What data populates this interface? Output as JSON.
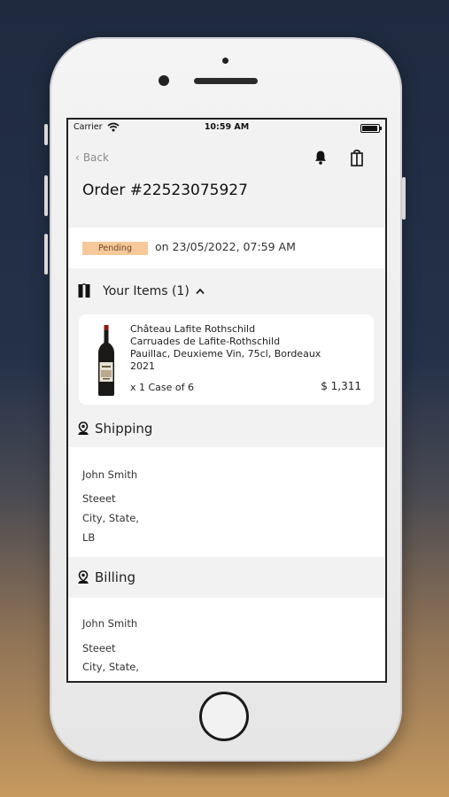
{
  "status_bar": {
    "carrier": "Carrier",
    "time": "10:59 AM"
  },
  "nav": {
    "back_label": "Back"
  },
  "order": {
    "title": "Order #22523075927",
    "status": "Pending",
    "date_text": "on 23/05/2022, 07:59 AM"
  },
  "items": {
    "header": "Your Items (1)",
    "list": [
      {
        "name": "Château Lafite Rothschild\nCarruades de Lafite-Rothschild\nPauillac, Deuxieme Vin, 75cl, Bordeaux\n2021",
        "quantity": "x 1 Case of 6",
        "price": "$ 1,311"
      }
    ]
  },
  "shipping": {
    "header": "Shipping",
    "name": "John Smith",
    "street": "Steeet",
    "city": "City, State,",
    "country": "LB"
  },
  "billing": {
    "header": "Billing",
    "name": "John Smith",
    "street": "Steeet",
    "city": "City, State,"
  },
  "colors": {
    "pending_badge": "#f6c89a",
    "screen_bg": "#f2f2f2"
  }
}
